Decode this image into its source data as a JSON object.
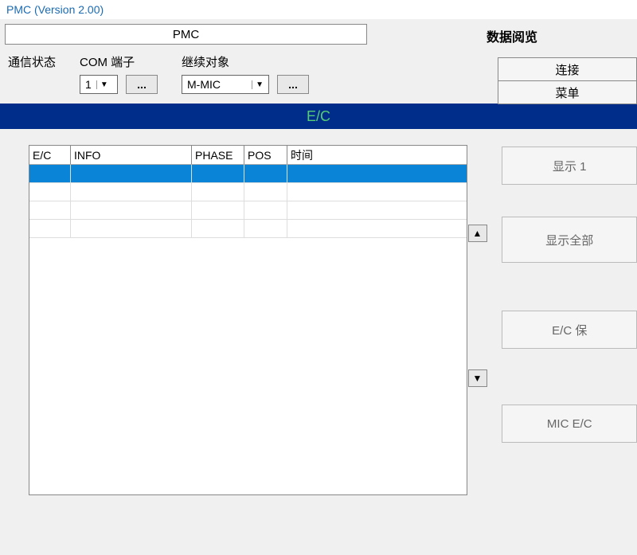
{
  "window": {
    "title": "PMC (Version 2.00)"
  },
  "header": {
    "pmc_tab": "PMC",
    "data_browse": "数据阅览"
  },
  "comm": {
    "status_label": "通信状态"
  },
  "com_port": {
    "label": "COM 端子",
    "value": "1",
    "browse": "..."
  },
  "continue_target": {
    "label": "继续对象",
    "value": "M-MIC",
    "browse": "..."
  },
  "right_buttons": {
    "connect": "连接",
    "menu": "菜单"
  },
  "banner": {
    "title": "E/C"
  },
  "table": {
    "headers": {
      "ec": "E/C",
      "info": "INFO",
      "phase": "PHASE",
      "pos": "POS",
      "time": "时间"
    }
  },
  "side_buttons": {
    "show_1": "显示 1",
    "show_all": "显示全部",
    "ec_save": "E/C 保",
    "mic_ec": "MIC E/C"
  }
}
